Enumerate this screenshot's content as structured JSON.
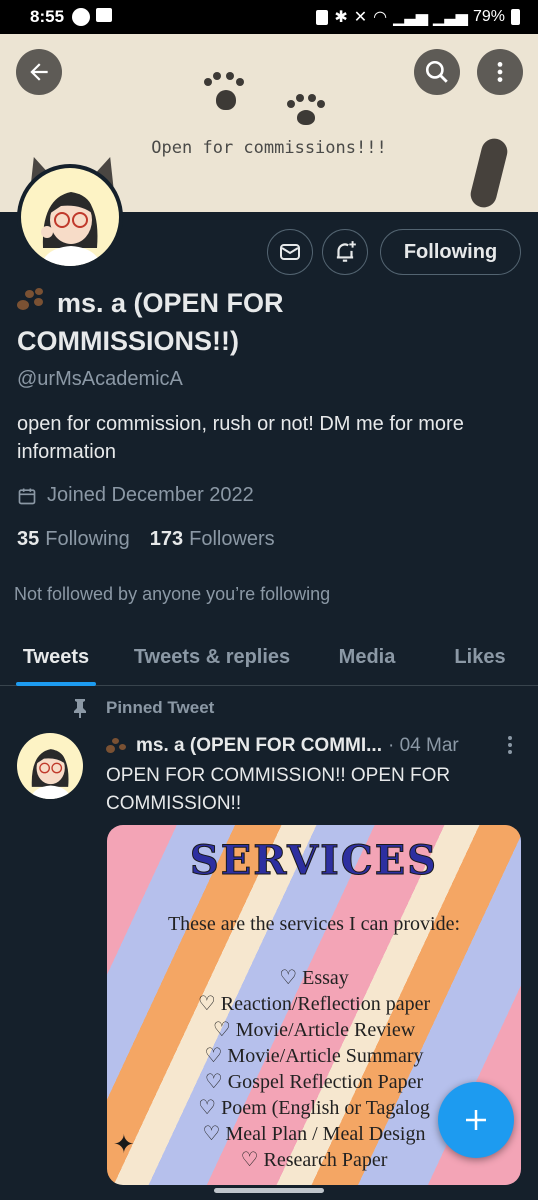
{
  "status_bar": {
    "time": "8:55",
    "battery": "79%"
  },
  "banner": {
    "text": "Open for commissions!!!"
  },
  "profile": {
    "display_name": "ms. a (OPEN FOR COMMISSIONS!!)",
    "handle": "@urMsAcademicA",
    "bio": "open for commission, rush or not! DM me for more information",
    "joined": "Joined December 2022",
    "following_count": "35",
    "following_label": "Following",
    "followers_count": "173",
    "followers_label": "Followers",
    "not_followed": "Not followed by anyone you’re following",
    "follow_button": "Following"
  },
  "tabs": [
    {
      "label": "Tweets",
      "active": true
    },
    {
      "label": "Tweets & replies",
      "active": false
    },
    {
      "label": "Media",
      "active": false
    },
    {
      "label": "Likes",
      "active": false
    }
  ],
  "tweet": {
    "pinned_label": "Pinned Tweet",
    "author": "ms. a (OPEN FOR COMMI...",
    "date": "· 04 Mar",
    "text": "OPEN FOR COMMISSION!! OPEN FOR COMMISSION!!",
    "image": {
      "title": "SERVICES",
      "subtitle": "These are the services I can provide:",
      "services": [
        "♡ Essay",
        "♡ Reaction/Reflection paper",
        "♡ Movie/Article Review",
        "♡ Movie/Article Summary",
        "♡ Gospel Reflection Paper",
        "♡ Poem (English or Tagalog",
        "♡ Meal Plan / Meal Design",
        "♡ Research Paper"
      ]
    }
  },
  "colors": {
    "accent": "#1d9bf0",
    "background": "#15202b",
    "secondary_text": "#8b98a5"
  }
}
